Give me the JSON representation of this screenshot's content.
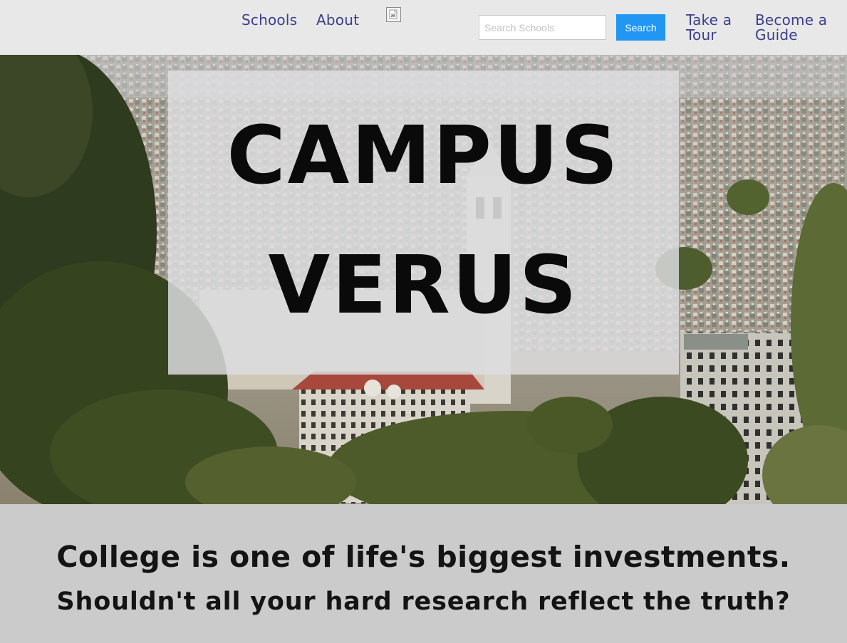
{
  "nav": {
    "schools_label": "Schools",
    "about_label": "About",
    "logo_icon": "broken-image-icon",
    "search": {
      "placeholder": "Search Schools",
      "value": "",
      "button_label": "Search"
    },
    "tour_label": "Take a Tour",
    "guide_label": "Become a Guide",
    "link_color": "#3b3f8a",
    "button_color": "#2196f3"
  },
  "hero": {
    "title_line_1": "CAMPUS",
    "title_line_2": "VERUS",
    "background_image": "campus-landscape-image"
  },
  "tagline": {
    "headline": "College is one of life's biggest investments.",
    "subheadline": "Shouldn't all your hard research reflect the truth?"
  }
}
